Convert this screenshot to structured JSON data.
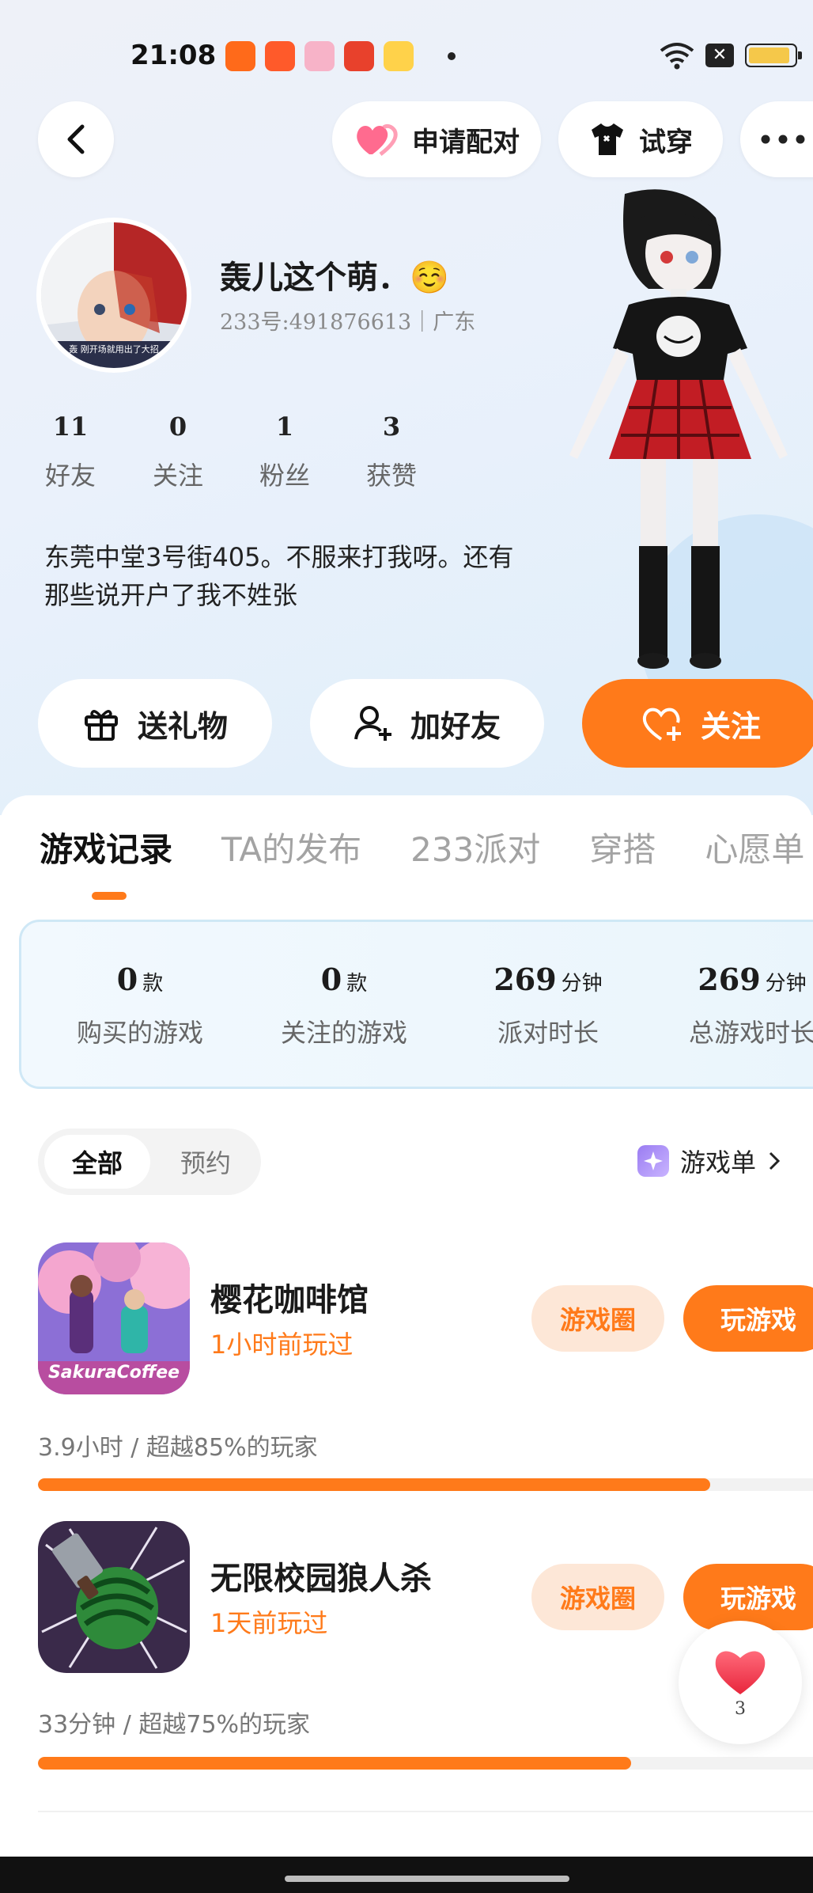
{
  "status_bar": {
    "time": "21:08"
  },
  "header": {
    "pair_label": "申请配对",
    "tryon_label": "试穿"
  },
  "profile": {
    "name": "轰儿这个萌．☺️",
    "uid_line": "233号:491876613｜广东",
    "avatar_caption": "轰 刚开场就用出了大招",
    "stats": [
      {
        "value": "11",
        "label": "好友"
      },
      {
        "value": "0",
        "label": "关注"
      },
      {
        "value": "1",
        "label": "粉丝"
      },
      {
        "value": "3",
        "label": "获赞"
      }
    ],
    "bio_line1": "东莞中堂3号街405。不服来打我呀。还有",
    "bio_line2": "那些说开户了我不姓张"
  },
  "actions": {
    "gift": "送礼物",
    "add_friend": "加好友",
    "follow": "关注"
  },
  "tabs": [
    "游戏记录",
    "TA的发布",
    "233派对",
    "穿搭",
    "心愿单"
  ],
  "summary": [
    {
      "value": "0",
      "unit": "款",
      "label": "购买的游戏"
    },
    {
      "value": "0",
      "unit": "款",
      "label": "关注的游戏"
    },
    {
      "value": "269",
      "unit": "分钟",
      "label": "派对时长"
    },
    {
      "value": "269",
      "unit": "分钟",
      "label": "总游戏时长"
    }
  ],
  "filter": {
    "all": "全部",
    "reserve": "预约",
    "game_list": "游戏单"
  },
  "games": [
    {
      "title": "樱花咖啡馆",
      "played": "1小时前玩过",
      "stat": "3.9小时 / 超越85%的玩家",
      "progress": 0.85,
      "icon_text": "SakuraCoffee",
      "circle_btn": "游戏圈",
      "play_btn": "玩游戏"
    },
    {
      "title": "无限校园狼人杀",
      "played": "1天前玩过",
      "stat": "33分钟 / 超越75%的玩家",
      "progress": 0.75,
      "circle_btn": "游戏圈",
      "play_btn": "玩游戏"
    }
  ],
  "like_float": {
    "count": "3"
  },
  "colors": {
    "accent": "#ff7a1a",
    "accent_light": "#fde7d7"
  }
}
